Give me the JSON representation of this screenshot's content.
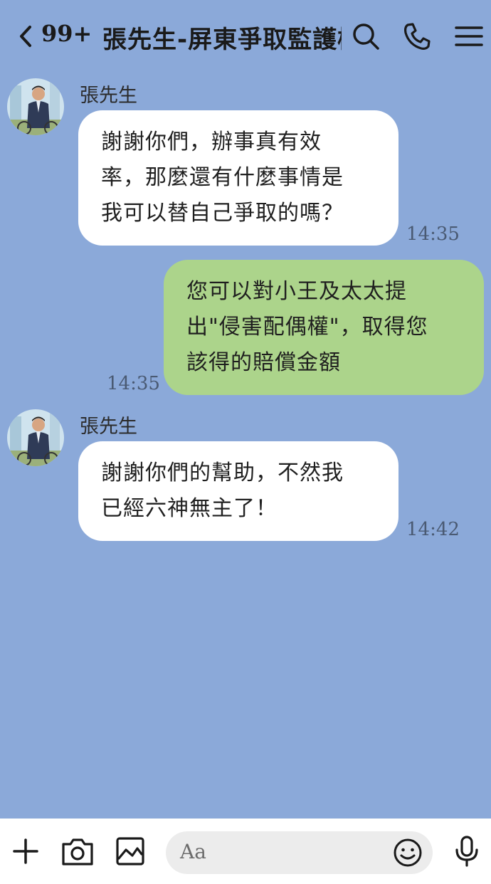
{
  "header": {
    "unread_count": "99+",
    "title": "張先生-屏東爭取監護權"
  },
  "messages": [
    {
      "direction": "incoming",
      "sender": "張先生",
      "lines": [
        "謝謝你們，辦事真有效",
        "率，那麼還有什麼事情是",
        "我可以替自己爭取的嗎？"
      ],
      "time": "14:35"
    },
    {
      "direction": "outgoing",
      "lines": [
        "您可以對小王及太太提",
        "出\"侵害配偶權\"，取得您",
        "該得的賠償金額"
      ],
      "time": "14:35"
    },
    {
      "direction": "incoming",
      "sender": "張先生",
      "lines": [
        "謝謝你們的幫助，不然我",
        "已經六神無主了！"
      ],
      "time": "14:42"
    }
  ],
  "input": {
    "placeholder": "Aa"
  },
  "colors": {
    "background": "#8ba9d9",
    "incoming_bubble": "#ffffff",
    "outgoing_bubble": "#acd48b"
  },
  "icons": [
    "back-icon",
    "search-icon",
    "phone-icon",
    "menu-icon",
    "plus-icon",
    "camera-icon",
    "image-icon",
    "emoji-icon",
    "mic-icon"
  ]
}
